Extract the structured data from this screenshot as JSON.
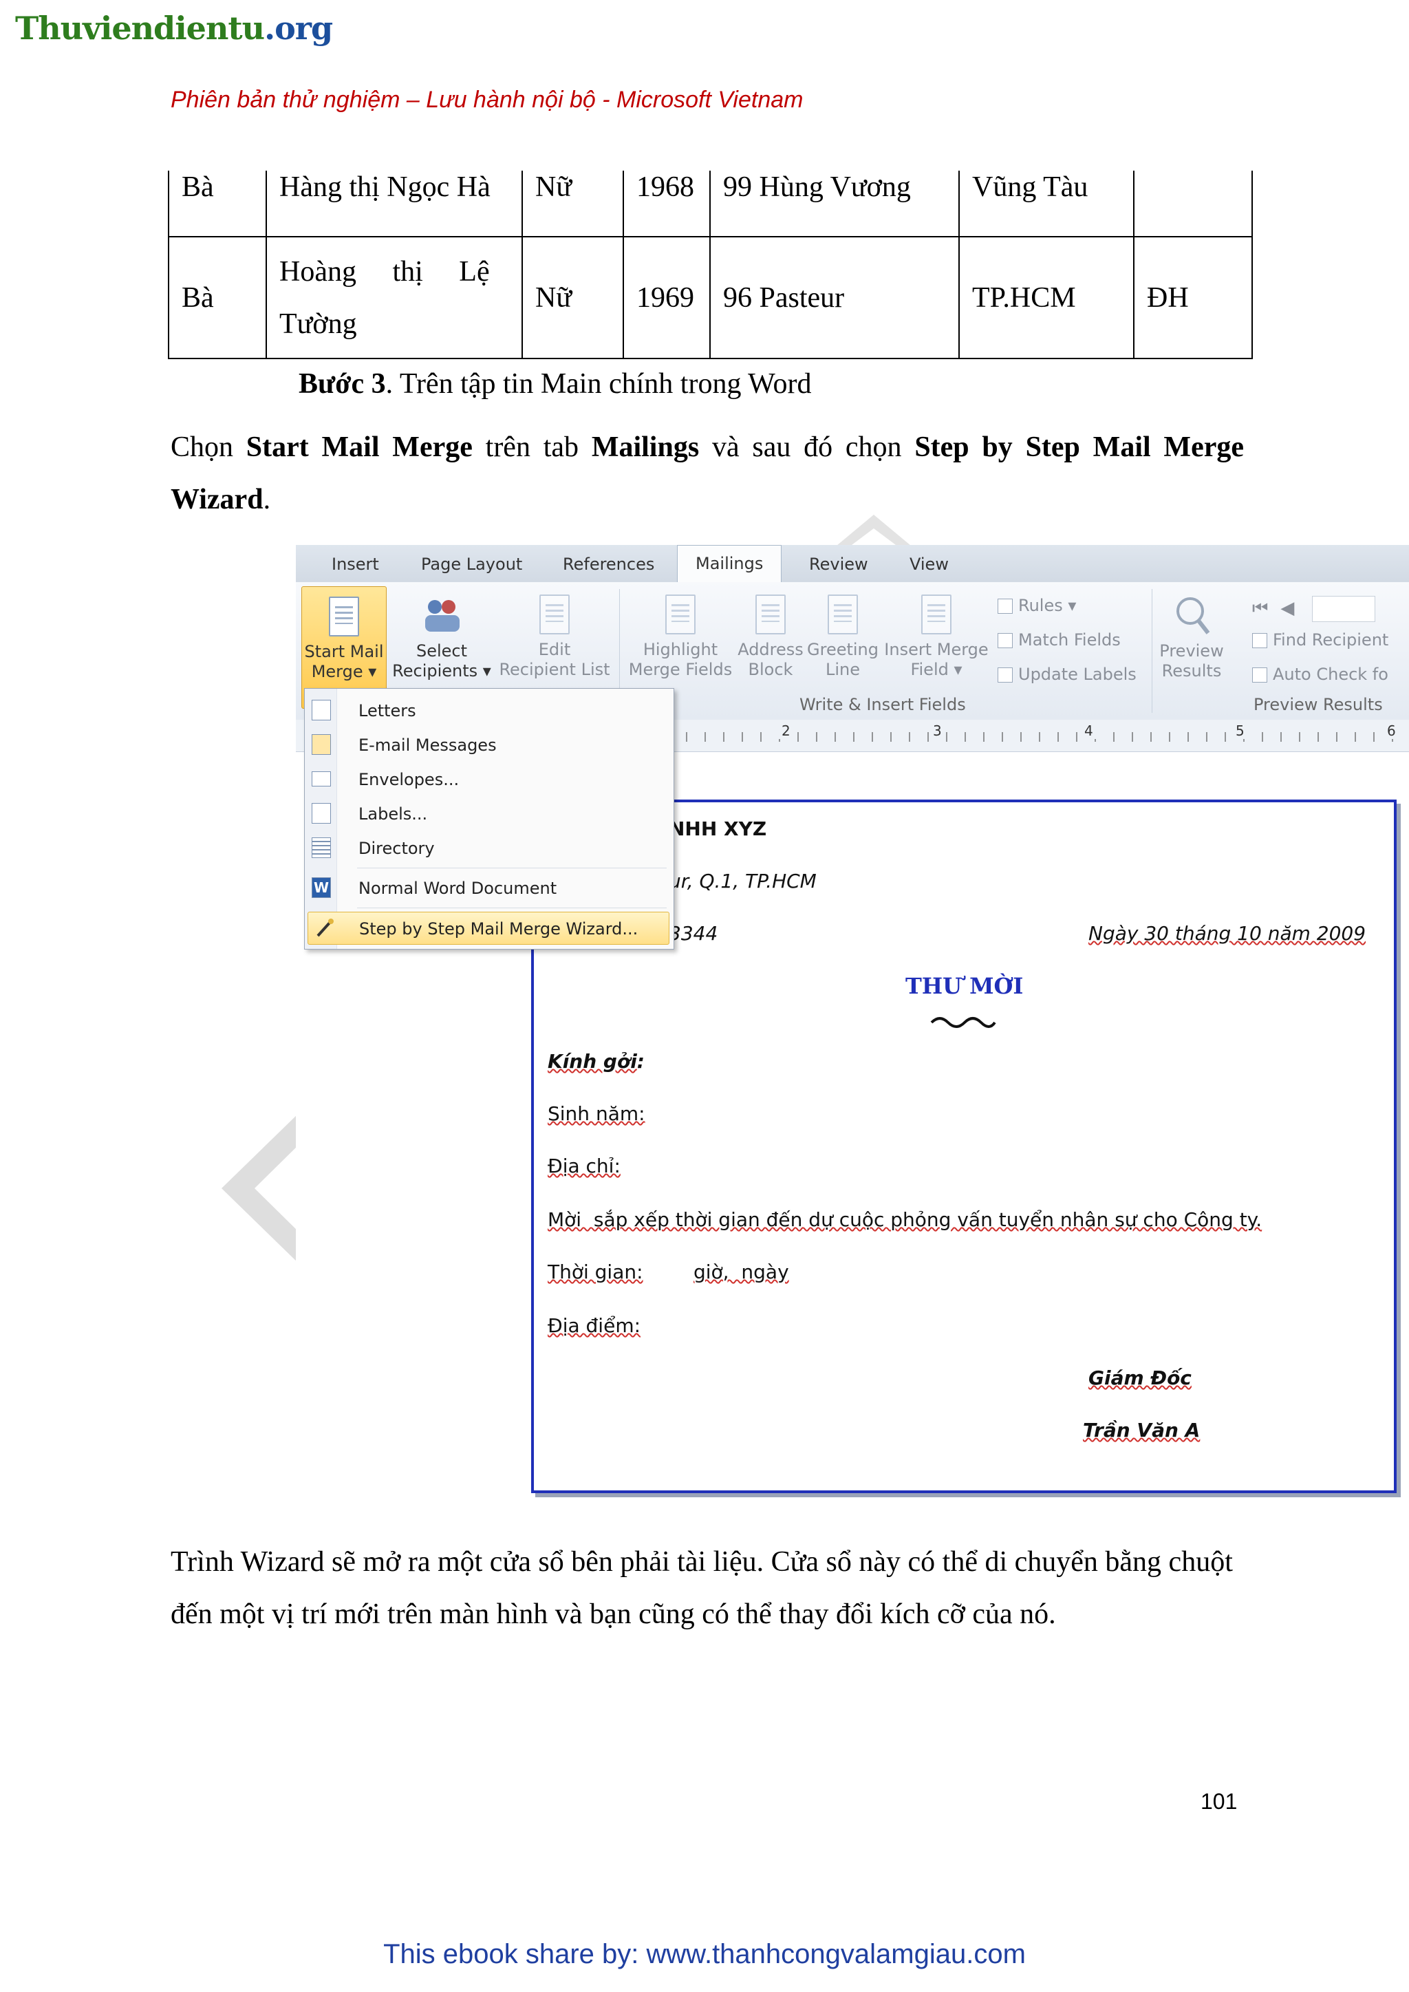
{
  "site_logo": {
    "part1": "Thuviendientu",
    "part2": ".org"
  },
  "header_subtitle": "Phiên bản thử nghiệm – Lưu hành nội bộ - Microsoft Vietnam",
  "table_rows": [
    {
      "title": "Bà",
      "name": "Hàng thị Ngọc Hà",
      "gender": "Nữ",
      "year": "1968",
      "address": "99 Hùng Vương",
      "city": "Vũng Tàu",
      "degree": ""
    },
    {
      "title": "Bà",
      "name_line1": "Hoàng     thị     Lệ",
      "name_line2": "Tường",
      "gender": "Nữ",
      "year": "1969",
      "address": "96 Pasteur",
      "city": "TP.HCM",
      "degree": "ĐH"
    }
  ],
  "step3": {
    "bold": "Bước 3",
    "rest": ". Trên tập tin Main chính trong Word"
  },
  "para1": {
    "t1": "Chọn ",
    "b1": "Start Mail Merge",
    "t2": " trên tab ",
    "b2": "Mailings",
    "t3": " và sau đó chọn ",
    "b3": "Step by Step Mail Merge Wizard",
    "t4": "."
  },
  "ribbon": {
    "tabs": [
      "Insert",
      "Page Layout",
      "References",
      "Mailings",
      "Review",
      "View"
    ],
    "active_tab": "Mailings",
    "start_mail_merge": {
      "line1": "Start Mail",
      "line2": "Merge ▾"
    },
    "select_recipients": {
      "line1": "Select",
      "line2": "Recipients ▾"
    },
    "edit_recipient_list": {
      "line1": "Edit",
      "line2": "Recipient List"
    },
    "highlight_merge_fields": {
      "line1": "Highlight",
      "line2": "Merge Fields"
    },
    "address_block": {
      "line1": "Address",
      "line2": "Block"
    },
    "greeting_line": {
      "line1": "Greeting",
      "line2": "Line"
    },
    "insert_merge_field": {
      "line1": "Insert Merge",
      "line2": "Field ▾"
    },
    "rules": "Rules ▾",
    "match_fields": "Match Fields",
    "update_labels": "Update Labels",
    "write_insert_group": "Write & Insert Fields",
    "preview_results": {
      "line1": "Preview",
      "line2": "Results"
    },
    "find_recipient": "Find Recipient",
    "auto_check": "Auto Check fo",
    "preview_group": "Preview Results"
  },
  "ruler_numbers": [
    "2",
    "3",
    "4",
    "5",
    "6"
  ],
  "menu_items": [
    {
      "label": "Letters",
      "icon": "letter-icon"
    },
    {
      "label": "E-mail Messages",
      "icon": "email-icon"
    },
    {
      "label": "Envelopes...",
      "icon": "envelope-icon"
    },
    {
      "label": "Labels...",
      "icon": "labels-icon"
    },
    {
      "label": "Directory",
      "icon": "directory-icon"
    },
    {
      "label": "Normal Word Document",
      "icon": "word-icon"
    },
    {
      "label": "Step by Step Mail Merge Wizard...",
      "icon": "wizard-icon"
    }
  ],
  "doc": {
    "company": "NHH XYZ",
    "address": "ur, Q.1, TP.HCM",
    "phone": "3344",
    "date": "Ngày 30 tháng 10 năm 2009",
    "heading": "THƯ MỜI",
    "kinh_goi": "Kính gởi",
    "sinh_nam": "Sinh năm:",
    "dia_chi": "Địa chỉ:",
    "invite": "Mời  sắp xếp thời gian đến dự cuộc phỏng vấn tuyển nhân sự cho Công ty.",
    "thoi_gian": "Thời gian:",
    "gio_ngay": "giờ,  ngày",
    "dia_diem": "Địa điểm:",
    "giam_doc": "Giám Đốc",
    "signer": "Trần Văn A"
  },
  "para2": "Trình Wizard sẽ mở ra một cửa sổ bên phải tài liệu. Cửa sổ này có thể di chuyển bằng chuột đến một vị trí mới trên màn hình và bạn cũng có thể thay đổi kích cỡ của nó.",
  "page_number": "101",
  "footer": {
    "prefix": "This ebook share by: ",
    "link": "www.thanhcongvalamgiau.com"
  },
  "colors": {
    "header_red": "#c00000",
    "footer_blue": "#1f3fa0",
    "doc_border": "#1f2fb8",
    "heading_blue": "#1f2fb8"
  }
}
